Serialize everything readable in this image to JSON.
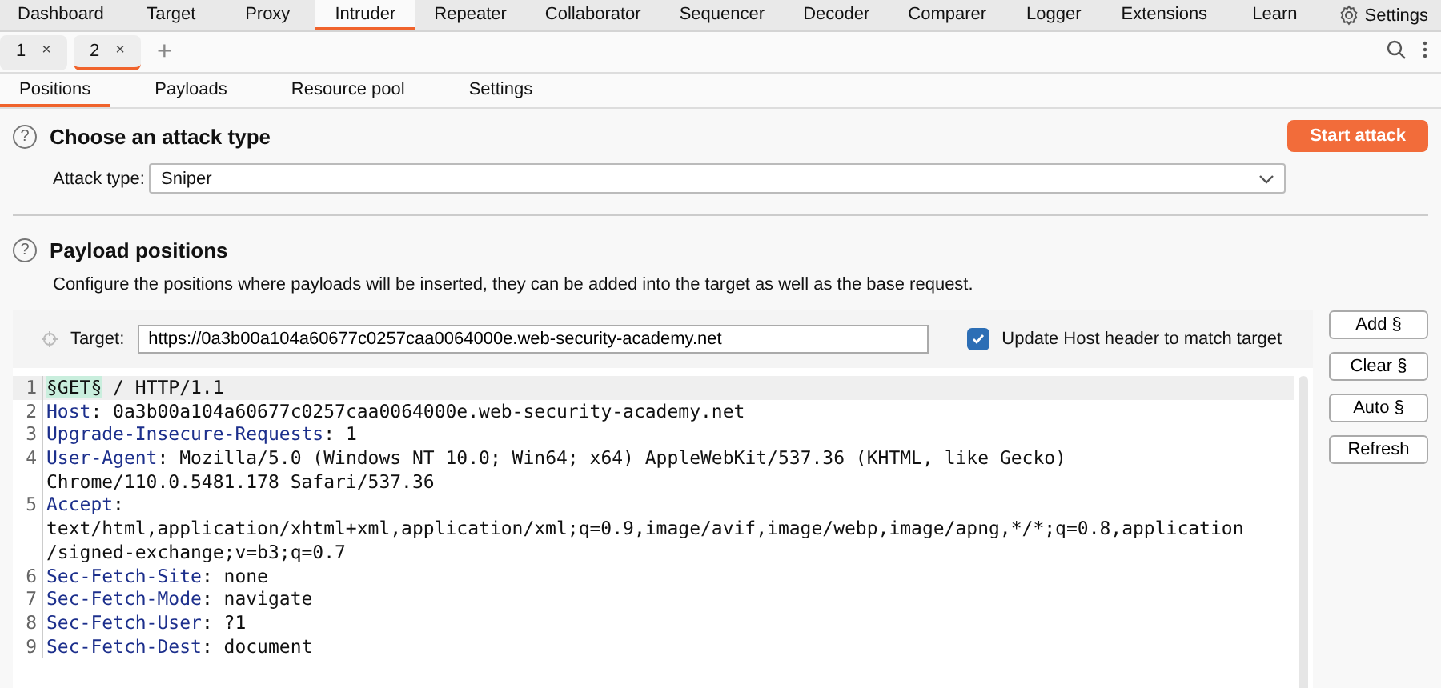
{
  "nav_tabs": [
    {
      "label": "Dashboard",
      "selected": false
    },
    {
      "label": "Target",
      "selected": false
    },
    {
      "label": "Proxy",
      "selected": false
    },
    {
      "label": "Intruder",
      "selected": true
    },
    {
      "label": "Repeater",
      "selected": false
    },
    {
      "label": "Collaborator",
      "selected": false
    },
    {
      "label": "Sequencer",
      "selected": false
    },
    {
      "label": "Decoder",
      "selected": false
    },
    {
      "label": "Comparer",
      "selected": false
    },
    {
      "label": "Logger",
      "selected": false
    },
    {
      "label": "Extensions",
      "selected": false
    },
    {
      "label": "Learn",
      "selected": false
    }
  ],
  "settings_label": "Settings",
  "attack_tabs": [
    {
      "label": "1",
      "close": "×",
      "selected": false
    },
    {
      "label": "2",
      "close": "×",
      "selected": true
    }
  ],
  "add_tab": "+",
  "sub_tabs": [
    {
      "label": "Positions",
      "selected": true
    },
    {
      "label": "Payloads",
      "selected": false
    },
    {
      "label": "Resource pool",
      "selected": false
    },
    {
      "label": "Settings",
      "selected": false
    }
  ],
  "attack_section": {
    "help": "?",
    "title": "Choose an attack type",
    "start_button": "Start attack",
    "attack_type_label": "Attack type:",
    "attack_type_value": "Sniper"
  },
  "positions_section": {
    "help": "?",
    "title": "Payload positions",
    "description": "Configure the positions where payloads will be inserted, they can be added into the target as well as the base request.",
    "target_label": "Target:",
    "target_value": "https://0a3b00a104a60677c0257caa0064000e.web-security-academy.net",
    "update_host": {
      "label": "Update Host header to match target",
      "checked": true
    },
    "buttons": [
      "Add §",
      "Clear §",
      "Auto §",
      "Refresh"
    ]
  },
  "request_lines": [
    {
      "number": "1",
      "marker": "§GET§",
      "text": " / HTTP/1.1",
      "highlighted": true
    },
    {
      "number": "2",
      "name": "Host",
      "text": ": 0a3b00a104a60677c0257caa0064000e.web-security-academy.net",
      "highlighted": false
    },
    {
      "number": "3",
      "name": "Upgrade-Insecure-Requests",
      "text": ": 1",
      "highlighted": false
    },
    {
      "number": "4",
      "name": "User-Agent",
      "text": ": Mozilla/5.0 (Windows NT 10.0; Win64; x64) AppleWebKit/537.36 (KHTML, like Gecko)",
      "wrap": [
        "Chrome/110.0.5481.178 Safari/537.36"
      ],
      "highlighted": false
    },
    {
      "number": "5",
      "name": "Accept",
      "text": ":",
      "wrap": [
        "text/html,application/xhtml+xml,application/xml;q=0.9,image/avif,image/webp,image/apng,*/*;q=0.8,application",
        "/signed-exchange;v=b3;q=0.7"
      ],
      "highlighted": false
    },
    {
      "number": "6",
      "name": "Sec-Fetch-Site",
      "text": ": none",
      "highlighted": false
    },
    {
      "number": "7",
      "name": "Sec-Fetch-Mode",
      "text": ": navigate",
      "highlighted": false
    },
    {
      "number": "8",
      "name": "Sec-Fetch-User",
      "text": ": ?1",
      "highlighted": false
    },
    {
      "number": "9",
      "name": "Sec-Fetch-Dest",
      "text": ": document",
      "highlighted": false
    }
  ]
}
